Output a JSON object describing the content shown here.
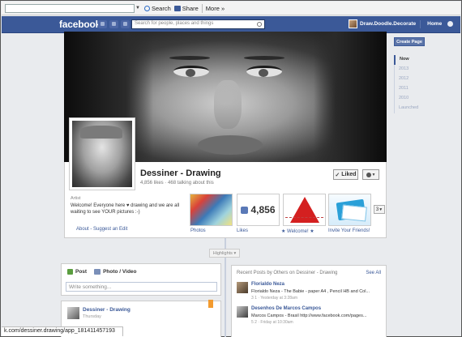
{
  "browser": {
    "search_label": "Search",
    "share_label": "Share",
    "more_label": "More »",
    "status_url": "k.com/dessiner.drawing/app_181411457193"
  },
  "topbar": {
    "logo": "facebook",
    "search_placeholder": "Search for people, places and things",
    "user_name": "Draw.Doodle.Decorate",
    "home_label": "Home"
  },
  "page": {
    "name": "Dessiner - Drawing",
    "stats": "4,856 likes · 468 talking about this",
    "liked_label": "Liked",
    "about_heading": "Artist",
    "about_text": "Welcome! Everyone here ♥ drawing and we are all waiting to see YOUR pictures :-)",
    "about_links": "About - Suggest an Edit"
  },
  "tiles": [
    {
      "label": "Photos"
    },
    {
      "label": "Likes",
      "count": "4,856"
    },
    {
      "label": "★ Welcome! ★"
    },
    {
      "label": "Invite Your Friends!"
    }
  ],
  "more_count": "3",
  "timeline": {
    "highlights_label": "Highlights ▾"
  },
  "composer": {
    "tab_post": "Post",
    "tab_photo": "Photo / Video",
    "placeholder": "Write something..."
  },
  "post": {
    "author": "Dessiner - Drawing",
    "time": "Thursday"
  },
  "recent": {
    "heading": "Recent Posts by Others on Dessiner - Drawing",
    "see_all": "See All",
    "items": [
      {
        "name": "Florialdo Neza",
        "text": "Florialdo Neza - The Babie - paper A4 , Pencil HB and Col...",
        "meta": "3  1 · Yesterday at 3:28am"
      },
      {
        "name": "Desenhos De Marcos Campos",
        "text": "Marcos Campos - Brasil http://www.facebook.com/pages...",
        "meta": "5  2 · Friday at 10:30am"
      }
    ]
  },
  "rail": {
    "create_page": "Create Page",
    "years": [
      "Now",
      "2013",
      "2012",
      "2011",
      "2010",
      "Launched"
    ]
  }
}
